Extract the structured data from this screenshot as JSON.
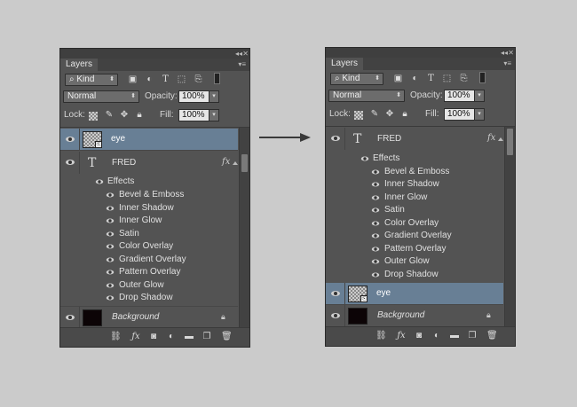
{
  "panels": [
    {
      "title_tab": "Layers",
      "filter_kind": "Kind",
      "blend_mode": "Normal",
      "opacity_label": "Opacity:",
      "opacity_value": "100%",
      "lock_label": "Lock:",
      "fill_label": "Fill:",
      "fill_value": "100%",
      "layers": {
        "eye": "eye",
        "fred": "FRED",
        "effects": "Effects",
        "background": "Background"
      },
      "effects": [
        "Bevel & Emboss",
        "Inner Shadow",
        "Inner Glow",
        "Satin",
        "Color Overlay",
        "Gradient Overlay",
        "Pattern Overlay",
        "Outer Glow",
        "Drop Shadow"
      ],
      "fx": "fx"
    },
    {
      "title_tab": "Layers",
      "filter_kind": "Kind",
      "blend_mode": "Normal",
      "opacity_label": "Opacity:",
      "opacity_value": "100%",
      "lock_label": "Lock:",
      "fill_label": "Fill:",
      "fill_value": "100%",
      "layers": {
        "eye": "eye",
        "fred": "FRED",
        "effects": "Effects",
        "background": "Background"
      },
      "effects": [
        "Bevel & Emboss",
        "Inner Shadow",
        "Inner Glow",
        "Satin",
        "Color Overlay",
        "Gradient Overlay",
        "Pattern Overlay",
        "Outer Glow",
        "Drop Shadow"
      ],
      "fx": "fx"
    }
  ],
  "colors": {
    "background": "#cbcbcb",
    "panel": "#535353",
    "selected_layer": "#687f95"
  }
}
